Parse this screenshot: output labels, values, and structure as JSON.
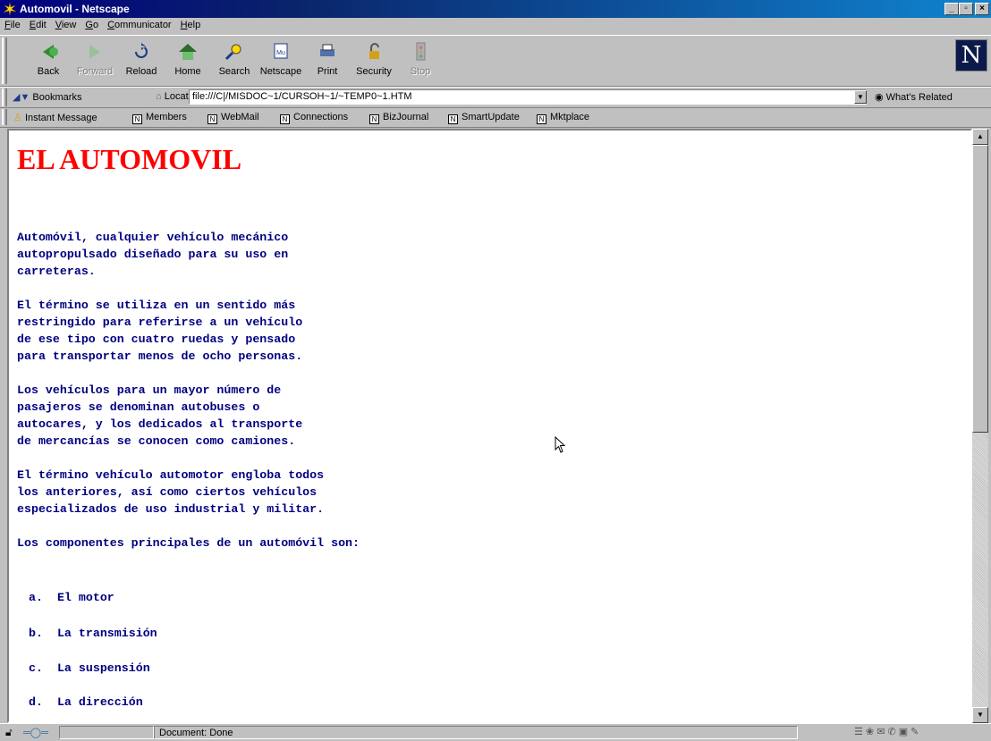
{
  "window": {
    "title": "Automovil - Netscape"
  },
  "menu": [
    "File",
    "Edit",
    "View",
    "Go",
    "Communicator",
    "Help"
  ],
  "toolbar": [
    {
      "label": "Back",
      "icon": "back-arrow-icon",
      "enabled": true
    },
    {
      "label": "Forward",
      "icon": "forward-arrow-icon",
      "enabled": false
    },
    {
      "label": "Reload",
      "icon": "reload-icon",
      "enabled": true
    },
    {
      "label": "Home",
      "icon": "home-icon",
      "enabled": true
    },
    {
      "label": "Search",
      "icon": "search-icon",
      "enabled": true
    },
    {
      "label": "Netscape",
      "icon": "netscape-icon",
      "enabled": true
    },
    {
      "label": "Print",
      "icon": "print-icon",
      "enabled": true
    },
    {
      "label": "Security",
      "icon": "lock-icon",
      "enabled": true
    },
    {
      "label": "Stop",
      "icon": "stop-icon",
      "enabled": false
    }
  ],
  "location": {
    "bookmarks_label": "Bookmarks",
    "location_label": "Location:",
    "url": "file:///C|/MISDOC~1/CURSOH~1/~TEMP0~1.HTM",
    "related_label": "What's Related"
  },
  "personal_toolbar": [
    "Instant Message",
    "Members",
    "WebMail",
    "Connections",
    "BizJournal",
    "SmartUpdate",
    "Mktplace"
  ],
  "page": {
    "title": "EL AUTOMOVIL",
    "paragraphs": [
      "Automóvil, cualquier vehículo mecánico\nautopropulsado diseñado para su uso en\ncarreteras.",
      "El término se utiliza en un sentido más\nrestringido para referirse a un vehículo\nde ese tipo con cuatro ruedas y pensado\npara transportar menos de ocho personas.",
      "Los vehículos para un mayor número de\npasajeros se denominan autobuses o\nautocares, y los dedicados al transporte\nde mercancías se conocen como camiones.",
      "El término vehículo automotor engloba todos\nlos anteriores, así como ciertos vehículos\nespecializados de uso industrial y militar.",
      "Los componentes principales de un automóvil son:"
    ],
    "list": [
      {
        "marker": "a.",
        "text": "El motor"
      },
      {
        "marker": "b.",
        "text": "La transmisión"
      },
      {
        "marker": "c.",
        "text": "La suspensión"
      },
      {
        "marker": "d.",
        "text": "La dirección"
      }
    ]
  },
  "status": {
    "text": "Document: Done"
  },
  "colors": {
    "title_red": "#ff0000",
    "text_navy": "#000080",
    "titlebar": "#000080"
  }
}
